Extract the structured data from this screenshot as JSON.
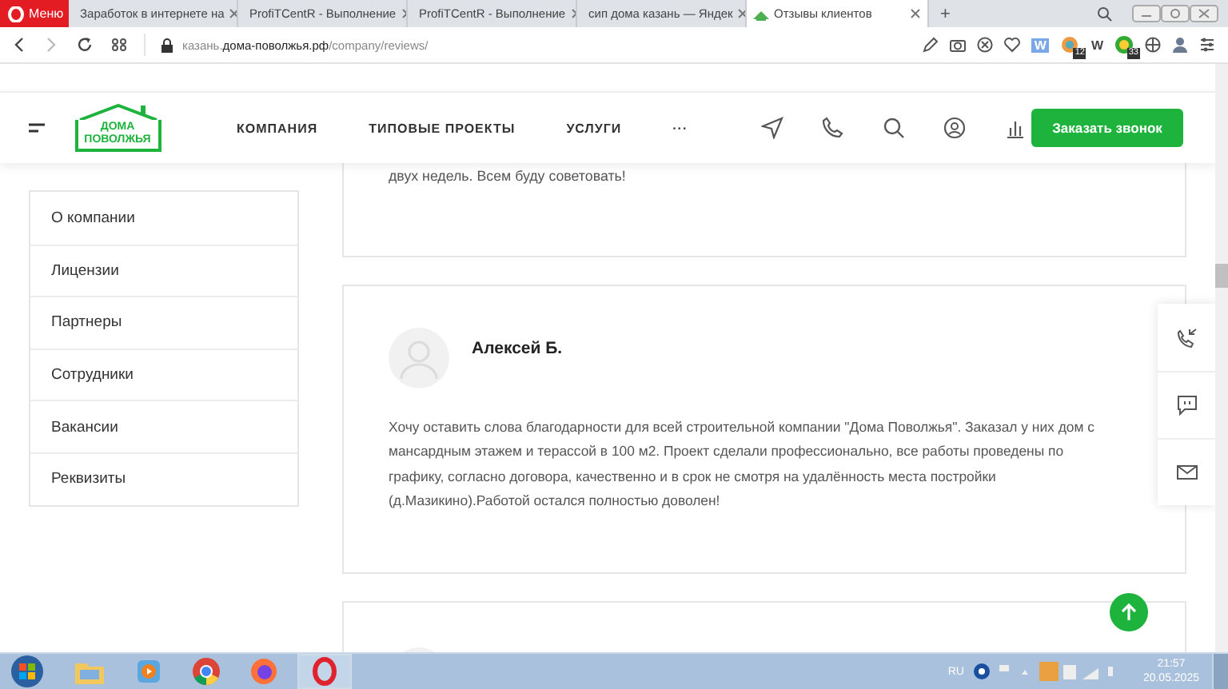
{
  "browser": {
    "menu_label": "Меню",
    "tabs": [
      {
        "title": "Заработок в интернете на",
        "kind": "sp",
        "selected": false
      },
      {
        "title": "ProfiTCentR - Выполнение",
        "kind": "chart",
        "selected": false
      },
      {
        "title": "ProfiTCentR - Выполнение",
        "kind": "chart",
        "selected": false
      },
      {
        "title": "сип дома казань — Яндек",
        "kind": "ya",
        "selected": false
      },
      {
        "title": "Отзывы клиентов",
        "kind": "house",
        "selected": true
      }
    ],
    "new_tab": "+",
    "url": "казань.**дома-поволжья.рф**/company/reviews/",
    "extensions": [
      {
        "label": "W",
        "kind": "word"
      },
      {
        "label": "12",
        "kind": "badge"
      },
      {
        "label": "W",
        "kind": "letter"
      },
      {
        "label": "33",
        "kind": "badge"
      }
    ]
  },
  "site": {
    "logo": "ДОМА ПОВОЛЖЬЯ",
    "nav": [
      "КОМПАНИЯ",
      "ТИПОВЫЕ ПРОЕКТЫ",
      "УСЛУГИ",
      "···"
    ],
    "cta": "Заказать звонок"
  },
  "sidebar": {
    "items": [
      {
        "label": "О компании",
        "selected": false
      },
      {
        "label": "Лицензии",
        "selected": false
      },
      {
        "label": "Партнеры",
        "selected": false
      },
      {
        "label": "Сотрудники",
        "selected": false
      },
      {
        "label": "Вакансии",
        "selected": false
      },
      {
        "label": "Реквизиты",
        "selected": false
      }
    ]
  },
  "reviews": [
    {
      "text": "двух недель. Всем буду советовать!",
      "kind": "cut"
    },
    {
      "author": "Алексей Б.",
      "text": "Хочу оставить слова благодарности для всей строительной компании \"Дома Поволжья\". Заказал у них дом с мансардным этажем и терассой в 100 м2. Проект сделали профессионально, все работы проведены по графику, согласно договора, качественно и в срок не смотря на удалённость места постройки (д.Мазикино).Работой остался полностью доволен!",
      "kind": "full"
    },
    {
      "kind": "top"
    }
  ],
  "taskbar": {
    "language": "RU",
    "time": "21:57",
    "date": "20.05.2025"
  }
}
